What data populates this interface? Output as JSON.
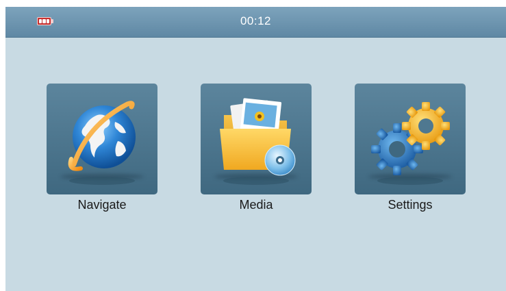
{
  "status_bar": {
    "time": "00:12",
    "battery_icon": "battery-icon"
  },
  "menu": {
    "items": [
      {
        "label": "Navigate",
        "icon": "globe-icon"
      },
      {
        "label": "Media",
        "icon": "media-folder-icon"
      },
      {
        "label": "Settings",
        "icon": "gears-icon"
      }
    ]
  },
  "colors": {
    "background": "#c8dae3",
    "status_bar": "#6a91ab",
    "tile": "#4f7890",
    "battery": "#c73030"
  }
}
